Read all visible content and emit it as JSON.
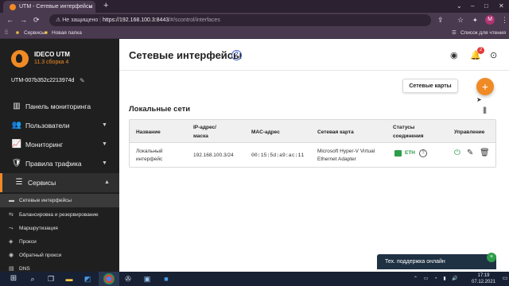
{
  "browser": {
    "tab_title": "UTM - Сетевые интерфейсы",
    "tab_close": "×",
    "new_tab": "+",
    "window_minimize": "–",
    "window_restore": "□",
    "window_close": "✕",
    "tab_search": "⌄",
    "nav_back": "←",
    "nav_forward": "→",
    "nav_reload": "⟳",
    "security_warning": "⚠ Не защищено",
    "url_host": "https://192.168.100.3:8443",
    "url_path": "/#/scontrol/interfaces",
    "share": "⇪",
    "star": "☆",
    "profile_letter": "M",
    "menu": "⋮",
    "bookmarks": [
      "Сервисы",
      "Новая папка"
    ],
    "reading_list": "Список для чтения"
  },
  "sidebar": {
    "brand": "IDECO UTM",
    "version": "11.3 сборка 4",
    "device_name": "UTM-007b352c2213974d",
    "device_edit": "✎",
    "items": [
      {
        "label": "Панель мониторинга",
        "icon": "▥",
        "chevron": ""
      },
      {
        "label": "Пользователи",
        "icon": "👥",
        "chevron": "▼"
      },
      {
        "label": "Мониторинг",
        "icon": "📈",
        "chevron": "▼"
      },
      {
        "label": "Правила трафика",
        "icon": "🛡",
        "chevron": "▼"
      },
      {
        "label": "Сервисы",
        "icon": "☰",
        "chevron": "▲"
      }
    ],
    "subitems": [
      {
        "label": "Сетевые интерфейсы",
        "icon": "▬"
      },
      {
        "label": "Балансировка и резервирование",
        "icon": "⇆"
      },
      {
        "label": "Маршрутизация",
        "icon": "⤳"
      },
      {
        "label": "Прокси",
        "icon": "◈"
      },
      {
        "label": "Обратный прокси",
        "icon": "◉"
      },
      {
        "label": "DNS",
        "icon": "▤"
      }
    ]
  },
  "main": {
    "title": "Сетевые интерфейсы",
    "help": "?",
    "notifications_count": "2",
    "adapters_button": "Сетевые карты",
    "add_button": "+",
    "section_title": "Локальные сети",
    "columns_icon": "|||",
    "table": {
      "headers": [
        "Название",
        "IP-адрес/ маска",
        "MAC-адрес",
        "Сетевая карта",
        "Статусы соединения",
        "Управление"
      ],
      "rows": [
        {
          "name": "Локальный интерфейс",
          "ip": "192.168.100.3/24",
          "mac": "00:15:5d:a9:ac:11",
          "adapter": "Microsoft Hyper-V Virtual Ethernet Adapter",
          "status": "ETH",
          "status_help": "?"
        }
      ]
    }
  },
  "support_chat": {
    "label": "Тех. поддержка онлайн",
    "close": "×"
  },
  "taskbar": {
    "time": "17:19",
    "date": "07.12.2021"
  }
}
